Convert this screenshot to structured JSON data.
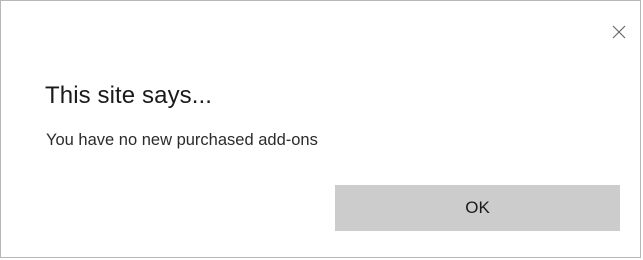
{
  "dialog": {
    "title": "This site says...",
    "message": "You have no new purchased add-ons",
    "ok_label": "OK",
    "close_icon": "close-icon"
  },
  "colors": {
    "background": "#ffffff",
    "border": "#b7b7b7",
    "button_bg": "#cccccc",
    "text": "#1a1a1a"
  }
}
